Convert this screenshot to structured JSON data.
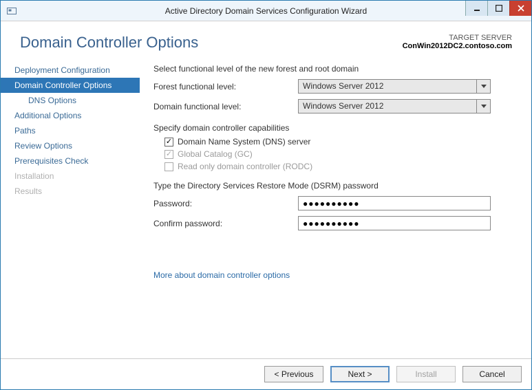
{
  "titlebar": {
    "title": "Active Directory Domain Services Configuration Wizard"
  },
  "header": {
    "page_title": "Domain Controller Options",
    "target_label": "TARGET SERVER",
    "target_name": "ConWin2012DC2.contoso.com"
  },
  "sidebar": {
    "items": [
      {
        "label": "Deployment Configuration",
        "state": "normal"
      },
      {
        "label": "Domain Controller Options",
        "state": "selected"
      },
      {
        "label": "DNS Options",
        "state": "normal",
        "sub": true
      },
      {
        "label": "Additional Options",
        "state": "normal"
      },
      {
        "label": "Paths",
        "state": "normal"
      },
      {
        "label": "Review Options",
        "state": "normal"
      },
      {
        "label": "Prerequisites Check",
        "state": "normal"
      },
      {
        "label": "Installation",
        "state": "disabled"
      },
      {
        "label": "Results",
        "state": "disabled"
      }
    ]
  },
  "main": {
    "functional_heading": "Select functional level of the new forest and root domain",
    "forest_level_label": "Forest functional level:",
    "forest_level_value": "Windows Server 2012",
    "domain_level_label": "Domain functional level:",
    "domain_level_value": "Windows Server 2012",
    "capabilities_heading": "Specify domain controller capabilities",
    "dns_label": "Domain Name System (DNS) server",
    "gc_label": "Global Catalog (GC)",
    "rodc_label": "Read only domain controller (RODC)",
    "dns_checked": true,
    "gc_checked": true,
    "rodc_checked": false,
    "dsrm_heading": "Type the Directory Services Restore Mode (DSRM) password",
    "password_label": "Password:",
    "confirm_label": "Confirm password:",
    "password_mask": "●●●●●●●●●●",
    "confirm_mask": "●●●●●●●●●●",
    "help_link": "More about domain controller options"
  },
  "footer": {
    "previous": "< Previous",
    "next": "Next >",
    "install": "Install",
    "cancel": "Cancel"
  }
}
